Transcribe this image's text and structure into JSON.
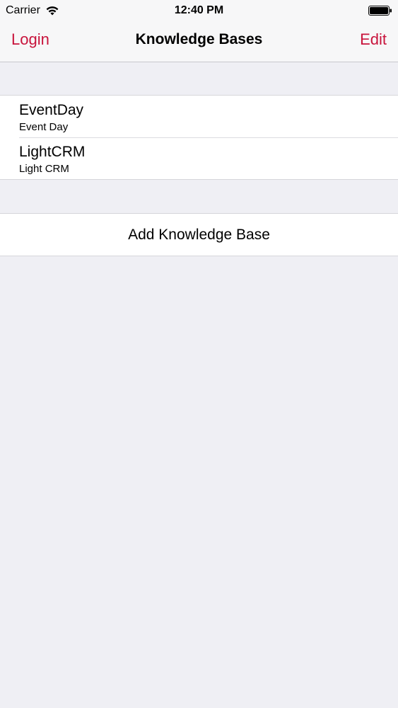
{
  "status_bar": {
    "carrier": "Carrier",
    "time": "12:40 PM",
    "wifi_icon": "wifi-icon",
    "battery_icon": "battery-icon"
  },
  "nav_bar": {
    "left_label": "Login",
    "title": "Knowledge Bases",
    "right_label": "Edit",
    "accent_color": "#c8143c"
  },
  "knowledge_bases": [
    {
      "name": "EventDay",
      "subtitle": "Event Day"
    },
    {
      "name": "LightCRM",
      "subtitle": "Light CRM"
    }
  ],
  "add_button": {
    "label": "Add Knowledge Base"
  },
  "colors": {
    "background": "#efeff4",
    "cell_background": "#ffffff",
    "separator": "#d6d6da"
  }
}
